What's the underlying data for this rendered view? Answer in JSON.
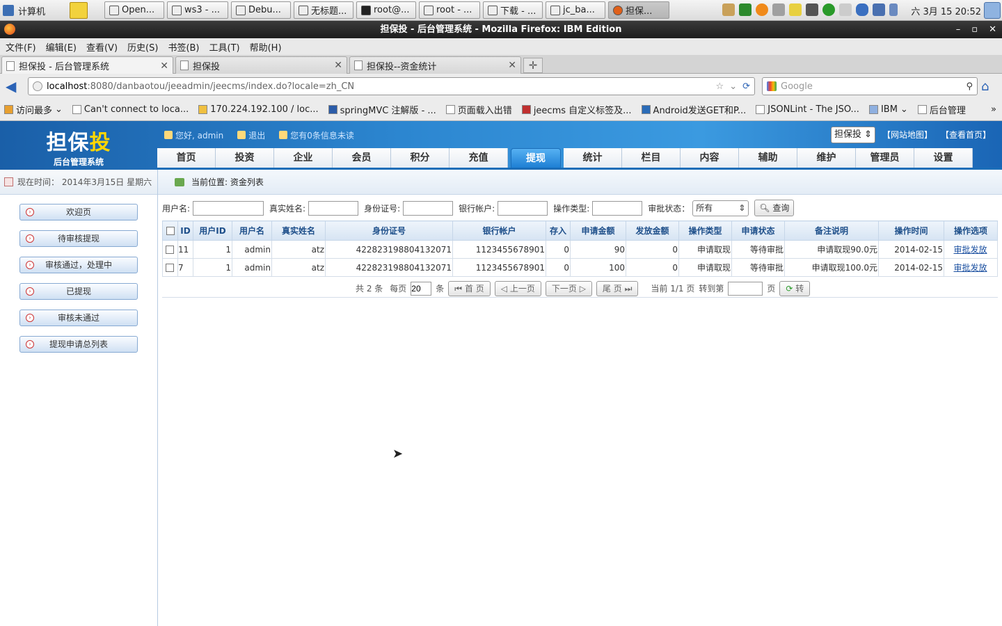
{
  "gnome": {
    "computer_label": "计算机",
    "tasks": [
      "Open...",
      "ws3 - ...",
      "Debu...",
      "无标题...",
      "root@...",
      "root - ...",
      "下载 - ...",
      "jc_ba...",
      "担保..."
    ],
    "clock": "六 3月 15 20:52"
  },
  "window": {
    "title": "担保投 - 后台管理系统 - Mozilla Firefox: IBM Edition"
  },
  "menu": [
    "文件(F)",
    "编辑(E)",
    "查看(V)",
    "历史(S)",
    "书签(B)",
    "工具(T)",
    "帮助(H)"
  ],
  "tabs": [
    {
      "label": "担保投 - 后台管理系统"
    },
    {
      "label": "担保投"
    },
    {
      "label": "担保投--资金统计"
    }
  ],
  "nav": {
    "url_host": "localhost",
    "url_rest": ":8080/danbaotou/jeeadmin/jeecms/index.do?locale=zh_CN",
    "search_placeholder": "Google"
  },
  "bookmarks": [
    "访问最多",
    "Can't connect to loca...",
    "170.224.192.100 / loc...",
    "springMVC 注解版 - ...",
    "页面载入出错",
    "jeecms 自定义标签及...",
    "Android发送GET和P...",
    "JSONLint - The JSO...",
    "IBM",
    "后台管理"
  ],
  "header": {
    "logo_main": "担保",
    "logo_accent": "投",
    "logo_sub": "后台管理系统",
    "greeting": "您好, admin",
    "logout": "退出",
    "messages": "您有0条信息未读",
    "site_select": "担保投",
    "sitemap": "【网站地图】",
    "view_home": "【查看首页】"
  },
  "main_nav": [
    "首页",
    "投资",
    "企业",
    "会员",
    "积分",
    "充值",
    "提现",
    "统计",
    "栏目",
    "内容",
    "辅助",
    "维护",
    "管理员",
    "设置"
  ],
  "sidebar": {
    "time_label": "现在时间： 2014年3月15日 星期六",
    "items": [
      "欢迎页",
      "待审核提现",
      "审核通过，处理中",
      "已提现",
      "审核未通过",
      "提现申请总列表"
    ]
  },
  "breadcrumb": "当前位置: 资金列表",
  "filter": {
    "username_label": "用户名:",
    "realname_label": "真实姓名:",
    "idcard_label": "身份证号:",
    "bank_label": "银行帐户:",
    "optype_label": "操作类型:",
    "status_label": "审批状态：",
    "status_value": "所有",
    "query_button": "查询"
  },
  "table": {
    "columns": [
      "ID",
      "用户ID",
      "用户名",
      "真实姓名",
      "身份证号",
      "银行帐户",
      "存入",
      "申请金额",
      "发放金额",
      "操作类型",
      "申请状态",
      "备注说明",
      "操作时间",
      "操作选项"
    ],
    "rows": [
      [
        "11",
        "1",
        "admin",
        "atz",
        "422823198804132071",
        "1123455678901",
        "0",
        "90",
        "0",
        "申请取现",
        "等待审批",
        "申请取现90.0元",
        "2014-02-15",
        "审批发放"
      ],
      [
        "7",
        "1",
        "admin",
        "atz",
        "422823198804132071",
        "1123455678901",
        "0",
        "100",
        "0",
        "申请取现",
        "等待审批",
        "申请取现100.0元",
        "2014-02-15",
        "审批发放"
      ]
    ]
  },
  "pager": {
    "total": "共 2 条",
    "per_page_label": "每页",
    "per_page_value": "20",
    "per_page_unit": "条",
    "first": "首 页",
    "prev": "上一页",
    "next": "下一页",
    "last": "尾 页",
    "current": "当前 1/1 页",
    "goto_label": "转到第",
    "goto_unit": "页",
    "goto_button": "转"
  }
}
